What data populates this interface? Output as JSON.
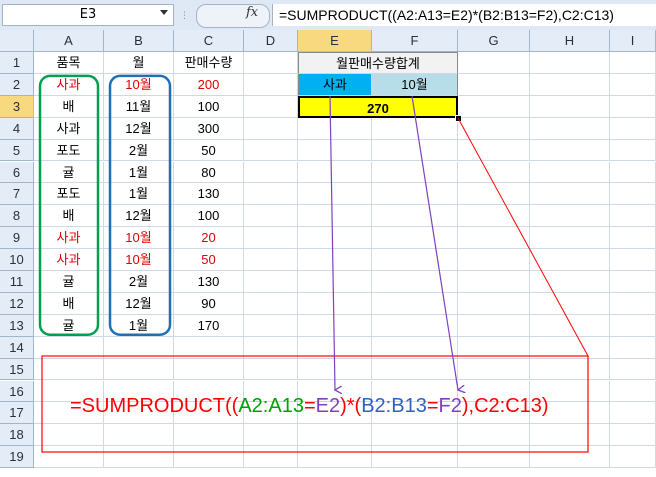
{
  "formula_bar": {
    "name_box": "E3",
    "fx_label": "fx",
    "formula": "=SUMPRODUCT((A2:A13=E2)*(B2:B13=F2),C2:C13)"
  },
  "columns": [
    "A",
    "B",
    "C",
    "D",
    "E",
    "F",
    "G",
    "H",
    "I"
  ],
  "rows": [
    "1",
    "2",
    "3",
    "4",
    "5",
    "6",
    "7",
    "8",
    "9",
    "10",
    "11",
    "12",
    "13",
    "14",
    "15",
    "16",
    "17",
    "18",
    "19"
  ],
  "table": {
    "headers": [
      "품목",
      "월",
      "판매수량"
    ],
    "rows": [
      {
        "item": "사과",
        "month": "10월",
        "qty": "200",
        "hl": true
      },
      {
        "item": "배",
        "month": "11월",
        "qty": "100",
        "hl": false
      },
      {
        "item": "사과",
        "month": "12월",
        "qty": "300",
        "hl": false
      },
      {
        "item": "포도",
        "month": "2월",
        "qty": "50",
        "hl": false
      },
      {
        "item": "귤",
        "month": "1월",
        "qty": "80",
        "hl": false
      },
      {
        "item": "포도",
        "month": "1월",
        "qty": "130",
        "hl": false
      },
      {
        "item": "배",
        "month": "12월",
        "qty": "100",
        "hl": false
      },
      {
        "item": "사과",
        "month": "10월",
        "qty": "20",
        "hl": true
      },
      {
        "item": "사과",
        "month": "10월",
        "qty": "50",
        "hl": true
      },
      {
        "item": "귤",
        "month": "2월",
        "qty": "130",
        "hl": false
      },
      {
        "item": "배",
        "month": "12월",
        "qty": "90",
        "hl": false
      },
      {
        "item": "귤",
        "month": "1월",
        "qty": "170",
        "hl": false
      }
    ]
  },
  "criteria": {
    "header": "월판매수량합계",
    "item": "사과",
    "month": "10월",
    "result": "270"
  },
  "big_formula": {
    "parts": [
      {
        "t": "=SUMPRODUCT((",
        "c": "#ff0000"
      },
      {
        "t": "A2:A13",
        "c": "#00a000"
      },
      {
        "t": "=",
        "c": "#ff0000"
      },
      {
        "t": "E2",
        "c": "#8040c0"
      },
      {
        "t": ")*(",
        "c": "#ff0000"
      },
      {
        "t": "B2:B13",
        "c": "#3060c0"
      },
      {
        "t": "=",
        "c": "#ff0000"
      },
      {
        "t": "F2",
        "c": "#8040c0"
      },
      {
        "t": "),C2:C13)",
        "c": "#ff0000"
      }
    ]
  },
  "colors": {
    "header_bg": "#e4ecf7",
    "selected_header": "#f8d980",
    "criteria_item_bg": "#00b0f0",
    "criteria_month_bg": "#b7dee8",
    "result_bg": "#ffff00",
    "annotation_red": "#ff0000",
    "annotation_green": "#00a050",
    "annotation_blue": "#1f6fb5",
    "annotation_purple": "#8040c0"
  }
}
